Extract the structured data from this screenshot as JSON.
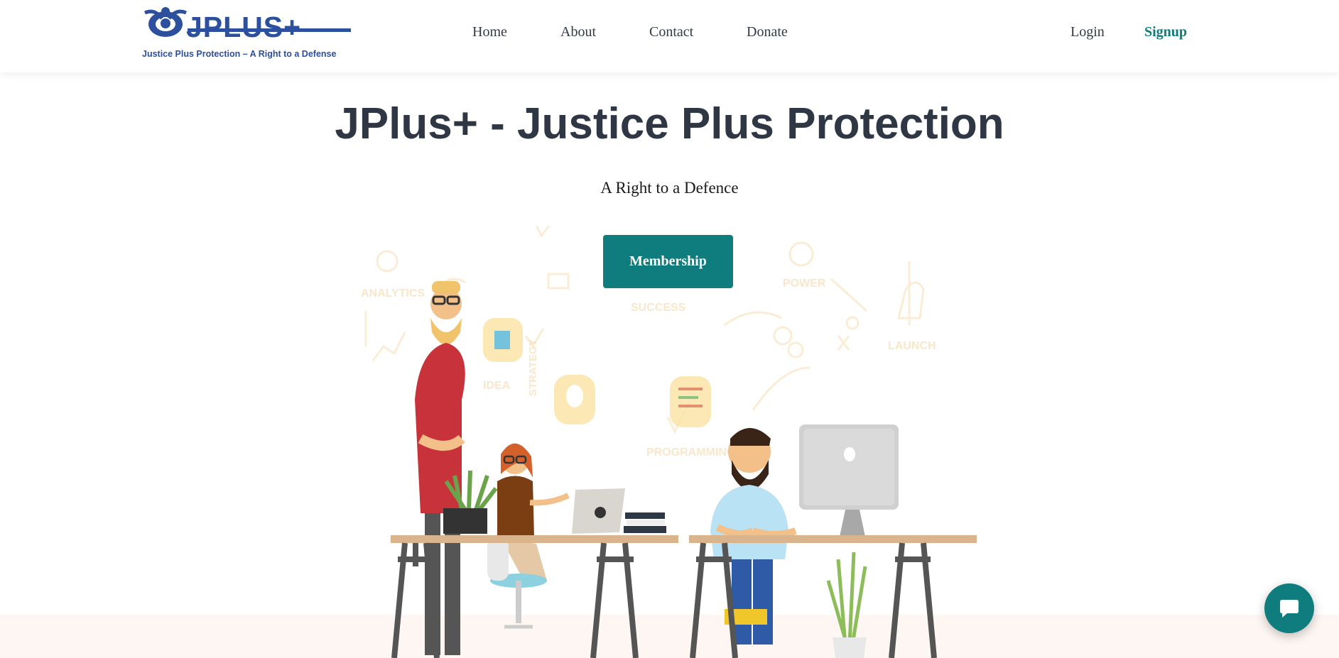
{
  "header": {
    "logo": {
      "wordmark": "JPLUS+",
      "tagline": "Justice Plus Protection – A Right to a Defense",
      "brand_color": "#2c4f9e"
    },
    "nav": [
      {
        "label": "Home"
      },
      {
        "label": "About"
      },
      {
        "label": "Contact"
      },
      {
        "label": "Donate"
      }
    ],
    "auth": {
      "login_label": "Login",
      "signup_label": "Signup"
    }
  },
  "hero": {
    "title": "JPlus+ - Justice Plus Protection",
    "subtitle": "A Right to a Defence",
    "cta_label": "Membership",
    "illustration": {
      "icon": "office-team-illustration",
      "background_words": [
        "ANALYTICS",
        "SUCCESS",
        "POWER",
        "LAUNCH",
        "IDEA",
        "STRATEGY",
        "PROGRAMMING"
      ]
    }
  },
  "chat_widget": {
    "icon": "chat-bubble-icon"
  },
  "colors": {
    "accent": "#0f7d7e",
    "heading": "#2f3745",
    "text": "#333a44",
    "band": "#fdf6f2"
  }
}
